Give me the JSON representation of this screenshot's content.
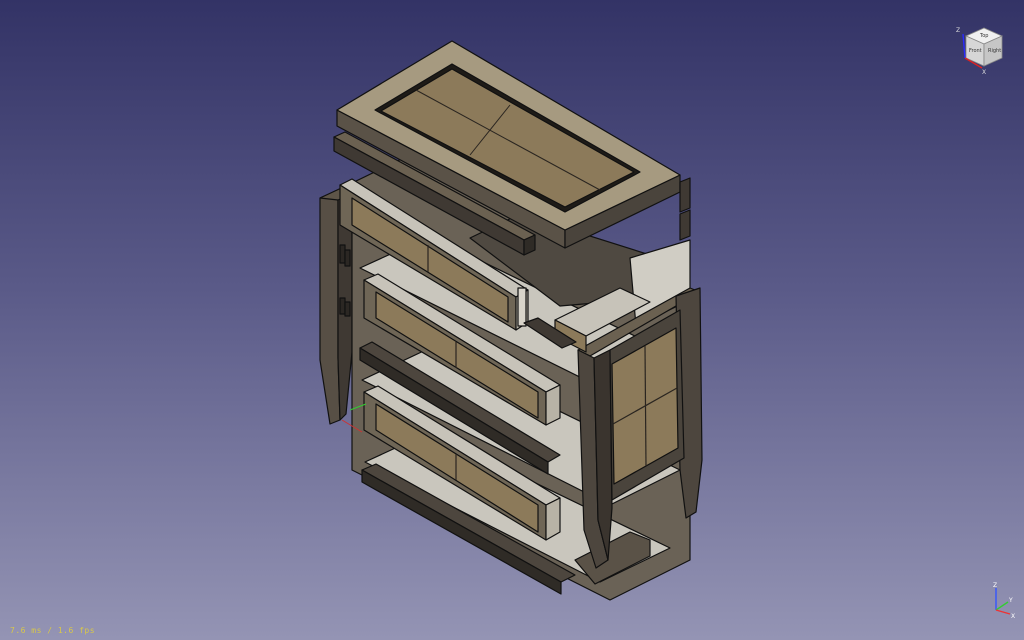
{
  "viewport": {
    "model": "exploded-dresser-assembly",
    "background_top": "#333366",
    "background_bottom": "#9494b4"
  },
  "colors": {
    "dark_wood": "#4d463e",
    "mid_wood": "#6b6151",
    "panel_light": "#8c7a5a",
    "light_gray": "#c9c6bd",
    "edge": "#111111"
  },
  "navcube": {
    "face_top": "Top",
    "face_front": "Front",
    "face_right": "Right",
    "axis_z": "Z",
    "axis_y": "Y",
    "axis_x": "X"
  },
  "axis_triad": {
    "z": "Z",
    "y": "Y",
    "x": "X"
  },
  "status": {
    "fps_text": "7.6 ms / 1.6 fps"
  }
}
